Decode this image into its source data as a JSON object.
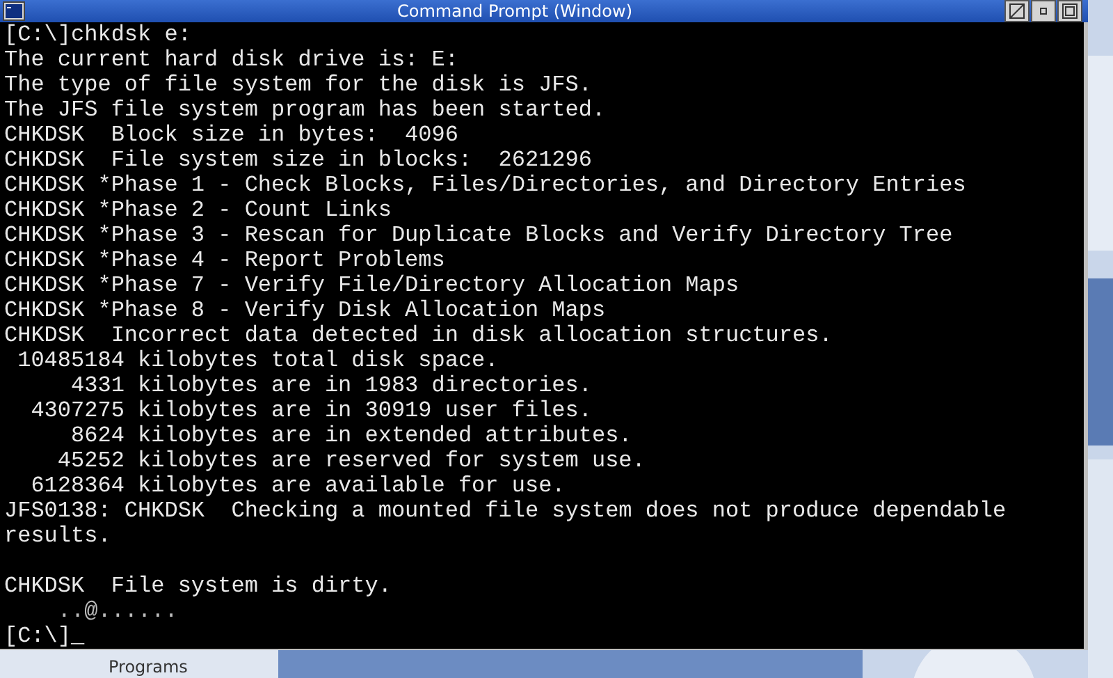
{
  "window": {
    "title": "Command Prompt (Window)"
  },
  "console": {
    "lines": [
      {
        "kind": "text",
        "text": "[C:\\]chkdsk e:"
      },
      {
        "kind": "text",
        "text": "The current hard disk drive is: E:"
      },
      {
        "kind": "text",
        "text": "The type of file system for the disk is JFS."
      },
      {
        "kind": "text",
        "text": "The JFS file system program has been started."
      },
      {
        "kind": "text",
        "text": "CHKDSK  Block size in bytes:  4096"
      },
      {
        "kind": "text",
        "text": "CHKDSK  File system size in blocks:  2621296"
      },
      {
        "kind": "text",
        "text": "CHKDSK *Phase 1 - Check Blocks, Files/Directories, and Directory Entries"
      },
      {
        "kind": "text",
        "text": "CHKDSK *Phase 2 - Count Links"
      },
      {
        "kind": "text",
        "text": "CHKDSK *Phase 3 - Rescan for Duplicate Blocks and Verify Directory Tree"
      },
      {
        "kind": "text",
        "text": "CHKDSK *Phase 4 - Report Problems"
      },
      {
        "kind": "text",
        "text": "CHKDSK *Phase 7 - Verify File/Directory Allocation Maps"
      },
      {
        "kind": "text",
        "text": "CHKDSK *Phase 8 - Verify Disk Allocation Maps"
      },
      {
        "kind": "text",
        "text": "CHKDSK  Incorrect data detected in disk allocation structures."
      },
      {
        "kind": "text",
        "text": " 10485184 kilobytes total disk space."
      },
      {
        "kind": "text",
        "text": "     4331 kilobytes are in 1983 directories."
      },
      {
        "kind": "text",
        "text": "  4307275 kilobytes are in 30919 user files."
      },
      {
        "kind": "text",
        "text": "     8624 kilobytes are in extended attributes."
      },
      {
        "kind": "text",
        "text": "    45252 kilobytes are reserved for system use."
      },
      {
        "kind": "text",
        "text": "  6128364 kilobytes are available for use."
      },
      {
        "kind": "text",
        "text": "JFS0138: CHKDSK  Checking a mounted file system does not produce dependable"
      },
      {
        "kind": "text",
        "text": "results."
      },
      {
        "kind": "blank"
      },
      {
        "kind": "text",
        "text": "CHKDSK  File system is dirty."
      },
      {
        "kind": "progress",
        "text": "    ..@......"
      },
      {
        "kind": "text",
        "text": "[C:\\]_"
      }
    ]
  },
  "taskbar": {
    "label": "Programs"
  }
}
